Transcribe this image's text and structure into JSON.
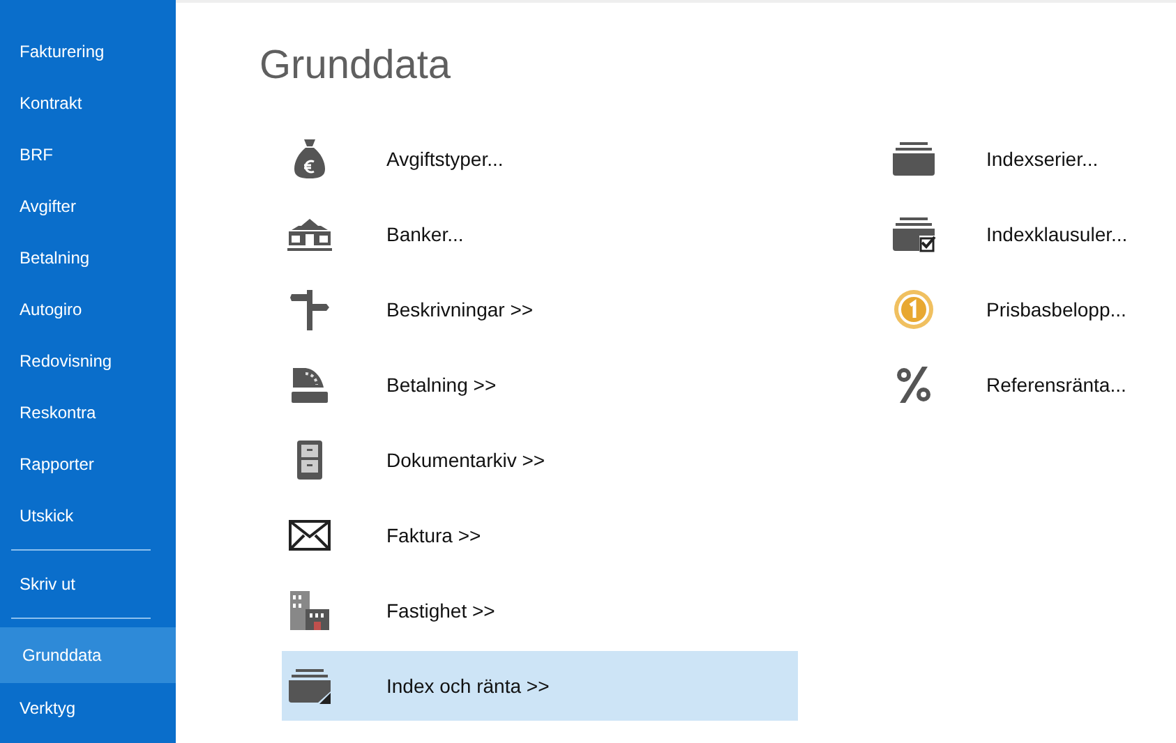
{
  "sidebar": {
    "items": [
      {
        "kind": "item",
        "label": "Fakturering",
        "selected": false
      },
      {
        "kind": "item",
        "label": "Kontrakt",
        "selected": false
      },
      {
        "kind": "item",
        "label": "BRF",
        "selected": false
      },
      {
        "kind": "item",
        "label": "Avgifter",
        "selected": false
      },
      {
        "kind": "item",
        "label": "Betalning",
        "selected": false
      },
      {
        "kind": "item",
        "label": "Autogiro",
        "selected": false
      },
      {
        "kind": "item",
        "label": "Redovisning",
        "selected": false
      },
      {
        "kind": "item",
        "label": "Reskontra",
        "selected": false
      },
      {
        "kind": "item",
        "label": "Rapporter",
        "selected": false
      },
      {
        "kind": "item",
        "label": "Utskick",
        "selected": false
      },
      {
        "kind": "separator"
      },
      {
        "kind": "item",
        "label": "Skriv ut",
        "selected": false
      },
      {
        "kind": "separator"
      },
      {
        "kind": "item",
        "label": "Grunddata",
        "selected": true
      },
      {
        "kind": "item",
        "label": "Verktyg",
        "selected": false
      }
    ]
  },
  "title": "Grunddata",
  "columns": [
    {
      "items": [
        {
          "label": "Avgiftstyper...",
          "selected": false
        },
        {
          "label": "Banker...",
          "selected": false
        },
        {
          "label": "Beskrivningar >>",
          "selected": false
        },
        {
          "label": "Betalning >>",
          "selected": false
        },
        {
          "label": "Dokumentarkiv >>",
          "selected": false
        },
        {
          "label": "Faktura >>",
          "selected": false
        },
        {
          "label": "Fastighet >>",
          "selected": false
        },
        {
          "label": "Index och ränta >>",
          "selected": true
        }
      ]
    },
    {
      "items": [
        {
          "label": "Indexserier...",
          "selected": false
        },
        {
          "label": "Indexklausuler...",
          "selected": false
        },
        {
          "label": "Prisbasbelopp...",
          "selected": false
        },
        {
          "label": "Referensränta...",
          "selected": false
        }
      ]
    }
  ]
}
